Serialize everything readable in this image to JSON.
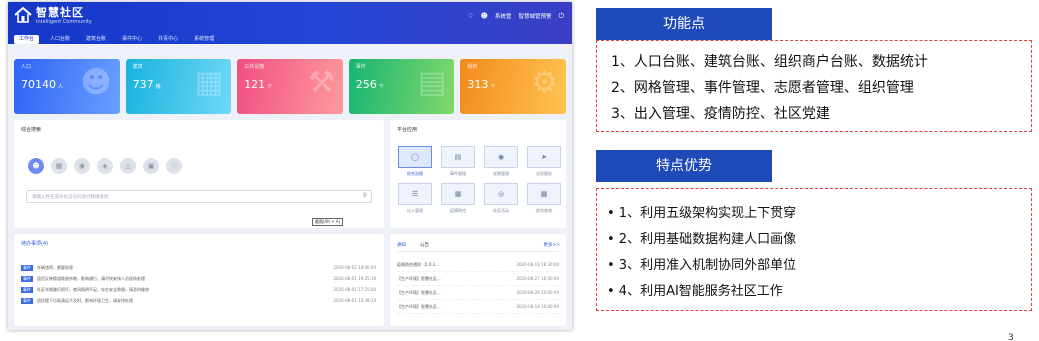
{
  "screenshot": {
    "app_title": "智慧社区",
    "app_subtitle": "Intelligent Community",
    "nav": [
      "工作台",
      "人口台账",
      "建筑台账",
      "事件中心",
      "共青中心",
      "系统管理"
    ],
    "header_right": {
      "user": "系统管",
      "org": "智慧城管预警",
      "icons": [
        "bell-icon",
        "user-icon",
        "power-icon"
      ]
    },
    "stats": [
      {
        "label": "人口",
        "value": "70140",
        "unit": "人",
        "icon": "person-icon",
        "color": "#2f63f5"
      },
      {
        "label": "建筑",
        "value": "737",
        "unit": "幢",
        "icon": "building-icon",
        "color": "#19b2e0"
      },
      {
        "label": "公共设施",
        "value": "121",
        "unit": "个",
        "icon": "wrench-icon",
        "color": "#f04f84"
      },
      {
        "label": "事件",
        "value": "256",
        "unit": "个",
        "icon": "calendar-icon",
        "color": "#17b574"
      },
      {
        "label": "组织",
        "value": "313",
        "unit": "个",
        "icon": "organization-icon",
        "color": "#f28a1c"
      }
    ],
    "search_panel": {
      "title": "综合搜索",
      "categories": [
        "person",
        "building",
        "facility",
        "event",
        "organization",
        "house",
        "volunteer"
      ],
      "placeholder": "请输入姓名或身份证号码进行精确查找",
      "tooltip": "截图(Alt + A)"
    },
    "platform_panel": {
      "title": "平台应用",
      "tiles": [
        "综合治理",
        "事件管理",
        "党建管理",
        "志愿服务",
        "出入管理",
        "疫情防控",
        "社区活动",
        "综合查询"
      ]
    },
    "todo_panel": {
      "title": "待办事项(4)",
      "items": [
        {
          "tag": "事件",
          "text": "车辆违停，需要处理",
          "time": "2020-08-02 18:00:00"
        },
        {
          "tag": "事件",
          "text": "居民反映楼道堆放杂物，影响通行，请尽快安排人员现场处理",
          "time": "2020-08-01 19:25:10"
        },
        {
          "tag": "事件",
          "text": "社区东侧路灯损坏，夜间照明不足，存在安全隐患，请及时维修",
          "time": "2020-08-01 17:25:00"
        },
        {
          "tag": "事件",
          "text": "居民楼下垃圾清运不及时，影响环境卫生，请安排处理",
          "time": "2020-08-01 13:38:14"
        }
      ]
    },
    "news_panel": {
      "tabs": [
        "通知",
        "公告"
      ],
      "more": "更多>>",
      "items": [
        {
          "text": "疫情防控通知（2.0.2...",
          "time": "2020-08-19 18:30:00"
        },
        {
          "text": "【生产环境】智慧社区...",
          "time": "2020-08-27 16:00:00"
        },
        {
          "text": "【生产环境】智慧社区...",
          "time": "2020-08-26 10:00:00"
        },
        {
          "text": "【生产环境】智慧社区...",
          "time": "2020-08-18 10:00:00"
        }
      ]
    }
  },
  "features": {
    "heading": "功能点",
    "lines": [
      "1、人口台账、建筑台账、组织商户台账、数据统计",
      "2、网格管理、事件管理、志愿者管理、组织管理",
      "3、出入管理、疫情防控、社区党建"
    ]
  },
  "advantages": {
    "heading": "特点优势",
    "lines": [
      "• 1、利用五级架构实现上下贯穿",
      "• 2、利用基础数据构建人口画像",
      "• 3、利用准入机制协同外部单位",
      "• 4、利用AI智能服务社区工作"
    ]
  },
  "page_number": "3"
}
